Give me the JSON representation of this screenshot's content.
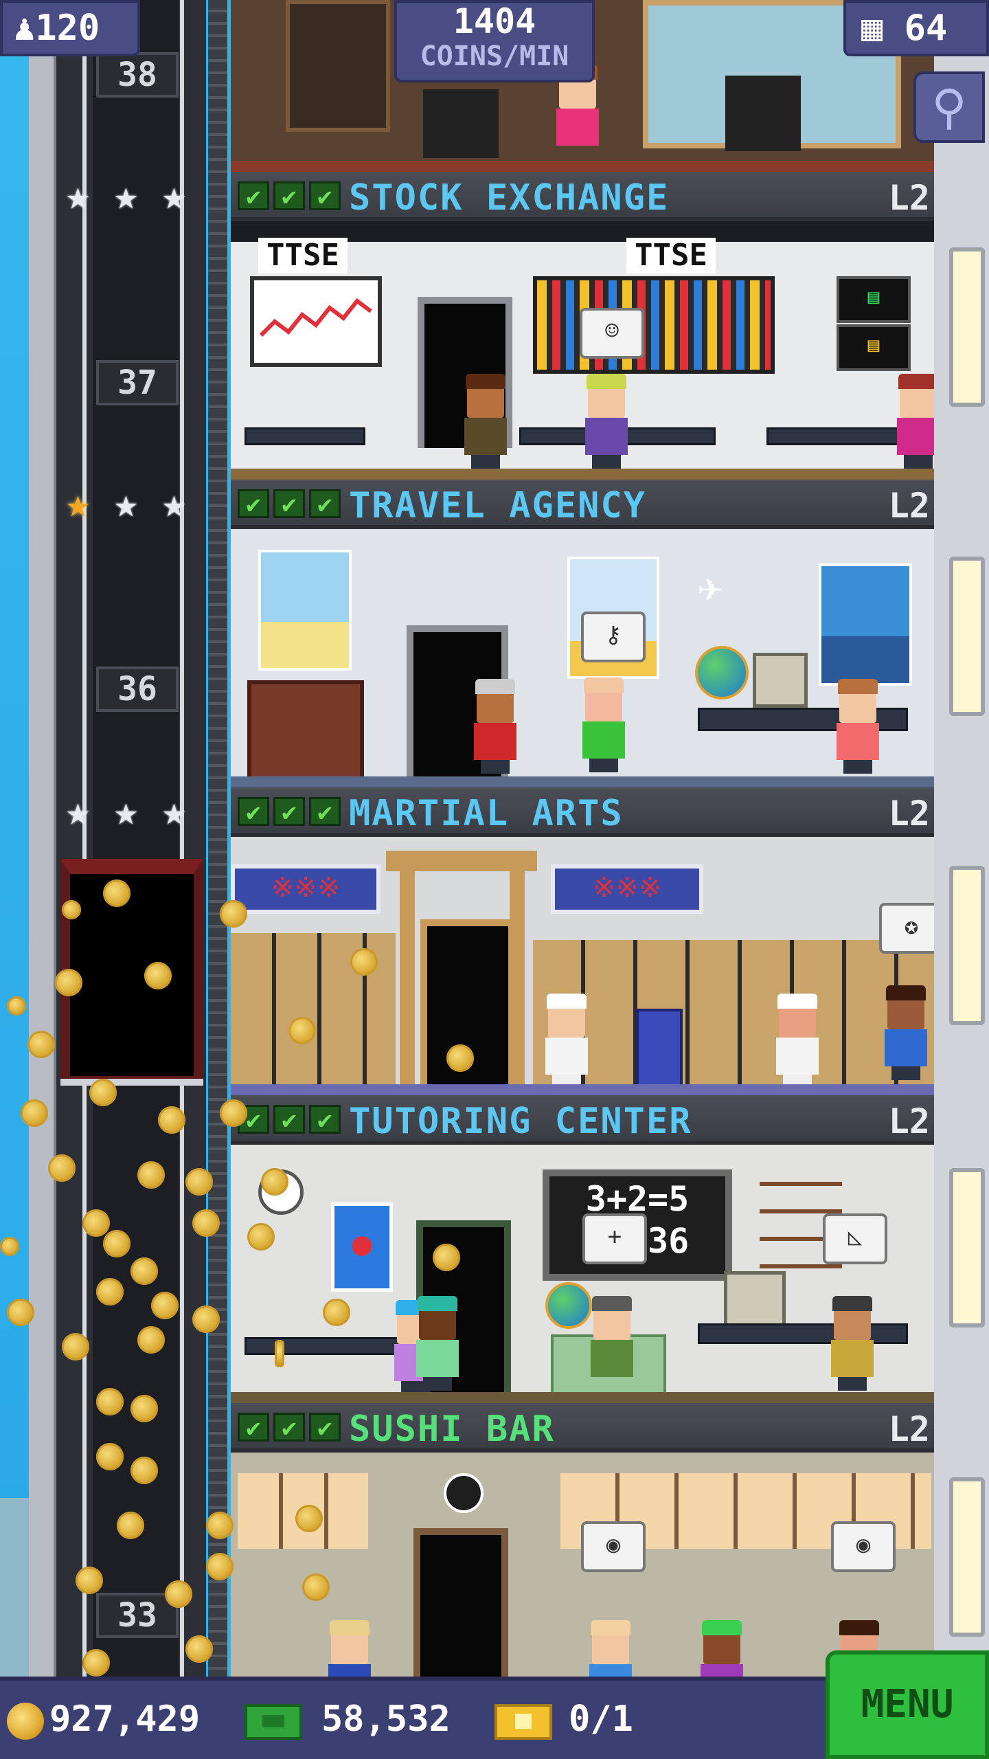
{
  "hud": {
    "population": "120",
    "coins_per_min_value": "1404",
    "coins_per_min_label": "COINS/MIN",
    "floors_count": "64"
  },
  "floors": [
    {
      "name": "STOCK EXCHANGE",
      "level": "L2",
      "name_color": "#5bc7f2",
      "floor_number": "37",
      "stars_gold": 0,
      "signs": [
        "TTSE",
        "TTSE"
      ]
    },
    {
      "name": "TRAVEL AGENCY",
      "level": "L2",
      "name_color": "#5bc7f2",
      "floor_number": "36",
      "stars_gold": 1
    },
    {
      "name": "MARTIAL ARTS",
      "level": "L2",
      "name_color": "#5bc7f2",
      "stars_gold": 0
    },
    {
      "name": "TUTORING CENTER",
      "level": "L2",
      "name_color": "#5bc7f2",
      "chalkboard_line1": "3+2=5",
      "chalkboard_line2": "6 =36"
    },
    {
      "name": "SUSHI BAR",
      "level": "L2",
      "name_color": "#56e07a",
      "floor_number": "33"
    }
  ],
  "top_floor_number": "38",
  "bottom_bar": {
    "coins": "927,429",
    "tower_bux": "58,532",
    "tickets": "0/1",
    "menu_label": "MENU"
  },
  "icons": {
    "population": "person-icon",
    "floors": "building-icon",
    "search": "magnifier-icon",
    "coins": "coin-icon",
    "bux": "bux-icon",
    "tickets": "golden-ticket-icon"
  },
  "colors": {
    "hud_bg": "#4a4d84",
    "menu_bg": "#2fbf3f",
    "sky": "#29b6ef"
  }
}
